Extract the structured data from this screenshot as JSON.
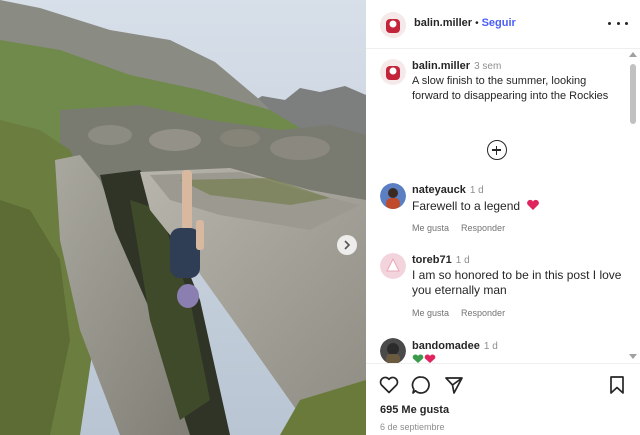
{
  "post": {
    "author": "balin.miller",
    "follow_label": "Seguir",
    "separator": "•",
    "caption_time": "3 sem",
    "caption": "A slow finish to the summer, looking forward to disappearing into the Rockies"
  },
  "comments": [
    {
      "user": "nateyauck",
      "time": "1 d",
      "text": "Farewell to a legend",
      "emoji": "heart",
      "like_label": "Me gusta",
      "reply_label": "Responder"
    },
    {
      "user": "toreb71",
      "time": "1 d",
      "text": "I am so honored to be in this post I love you eternally man",
      "like_label": "Me gusta",
      "reply_label": "Responder"
    },
    {
      "user": "bandomadee",
      "time": "1 d",
      "text": "",
      "emoji": "hearts"
    }
  ],
  "footer": {
    "likes": "695 Me gusta",
    "date": "6 de septiembre"
  },
  "icons": {
    "like": "heart-outline-icon",
    "comment": "speech-bubble-icon",
    "share": "paper-plane-icon",
    "save": "bookmark-icon",
    "more": "ellipsis-icon",
    "add_comment": "plus-circle-icon",
    "next": "chevron-right-icon"
  },
  "colors": {
    "accent": "#4a5df9",
    "heart": "#e0245e",
    "text": "#262626",
    "muted": "#8e8e8e"
  }
}
